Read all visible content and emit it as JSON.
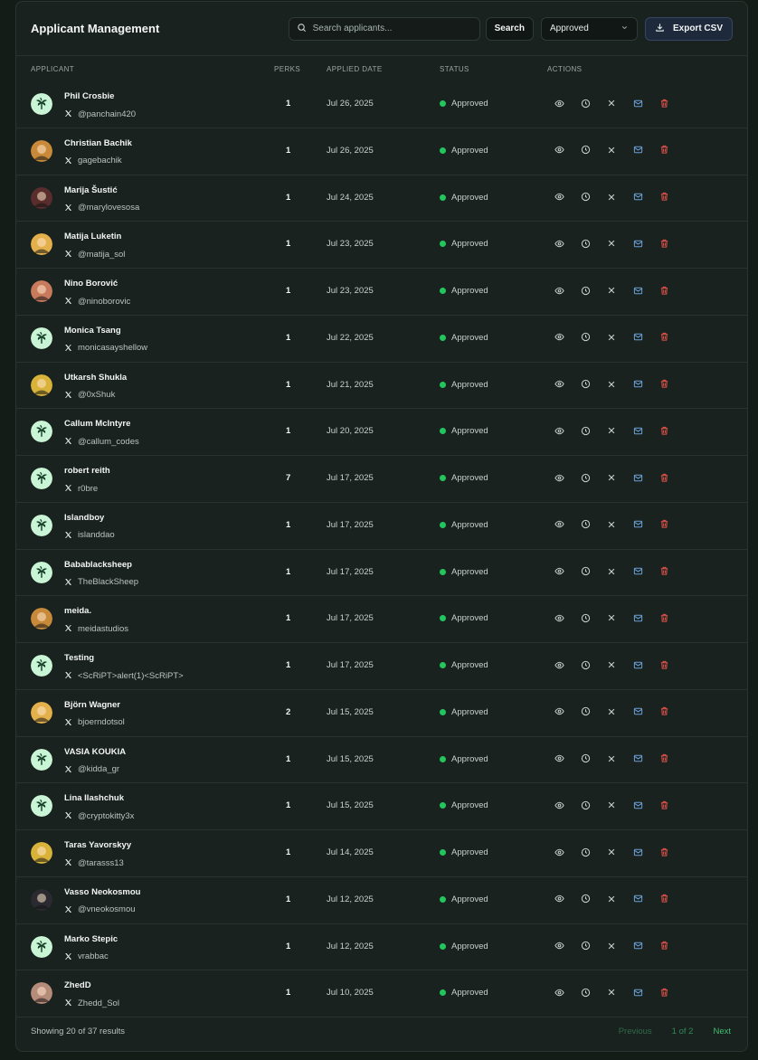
{
  "header": {
    "title": "Applicant Management",
    "search_placeholder": "Search applicants...",
    "search_label": "Search",
    "filter_value": "Approved",
    "export_label": "Export CSV"
  },
  "columns": {
    "applicant": "APPLICANT",
    "perks": "PERKS",
    "date": "APPLIED DATE",
    "status": "STATUS",
    "actions": "ACTIONS"
  },
  "colors": {
    "accent_green": "#22c55e",
    "delete_red": "#e5534b",
    "mail_blue": "#6a9fd4"
  },
  "rows": [
    {
      "name": "Phil Crosbie",
      "handle": "@panchain420",
      "perks": "1",
      "date": "Jul 26, 2025",
      "status": "Approved",
      "avatar": "palm-icon"
    },
    {
      "name": "Christian Bachik",
      "handle": "gagebachik",
      "perks": "1",
      "date": "Jul 26, 2025",
      "status": "Approved",
      "avatar": "photo"
    },
    {
      "name": "Marija Šustić",
      "handle": "@marylovesosa",
      "perks": "1",
      "date": "Jul 24, 2025",
      "status": "Approved",
      "avatar": "photo"
    },
    {
      "name": "Matija Luketin",
      "handle": "@matija_sol",
      "perks": "1",
      "date": "Jul 23, 2025",
      "status": "Approved",
      "avatar": "photo"
    },
    {
      "name": "Nino Borović",
      "handle": "@ninoborovic",
      "perks": "1",
      "date": "Jul 23, 2025",
      "status": "Approved",
      "avatar": "photo"
    },
    {
      "name": "Monica Tsang",
      "handle": "monicasayshellow",
      "perks": "1",
      "date": "Jul 22, 2025",
      "status": "Approved",
      "avatar": "palm-icon"
    },
    {
      "name": "Utkarsh Shukla",
      "handle": "@0xShuk",
      "perks": "1",
      "date": "Jul 21, 2025",
      "status": "Approved",
      "avatar": "photo"
    },
    {
      "name": "Callum McIntyre",
      "handle": "@callum_codes",
      "perks": "1",
      "date": "Jul 20, 2025",
      "status": "Approved",
      "avatar": "palm-icon"
    },
    {
      "name": "robert reith",
      "handle": "r0bre",
      "perks": "7",
      "date": "Jul 17, 2025",
      "status": "Approved",
      "avatar": "palm-icon"
    },
    {
      "name": "Islandboy",
      "handle": "islanddao",
      "perks": "1",
      "date": "Jul 17, 2025",
      "status": "Approved",
      "avatar": "palm-icon"
    },
    {
      "name": "Bababl​acksheep",
      "handle": "TheBlackSheep",
      "perks": "1",
      "date": "Jul 17, 2025",
      "status": "Approved",
      "avatar": "palm-icon"
    },
    {
      "name": "meida.",
      "handle": "meidastudios",
      "perks": "1",
      "date": "Jul 17, 2025",
      "status": "Approved",
      "avatar": "photo"
    },
    {
      "name": "Testing",
      "handle": "<ScRiPT>alert(1)<ScRiPT>",
      "perks": "1",
      "date": "Jul 17, 2025",
      "status": "Approved",
      "avatar": "palm-icon"
    },
    {
      "name": "Björn Wagner",
      "handle": "bjoerndotsol",
      "perks": "2",
      "date": "Jul 15, 2025",
      "status": "Approved",
      "avatar": "photo"
    },
    {
      "name": "VASIA KOUKIA",
      "handle": "@kidda_gr",
      "perks": "1",
      "date": "Jul 15, 2025",
      "status": "Approved",
      "avatar": "palm-icon"
    },
    {
      "name": "Lina Ilashchuk",
      "handle": "@cryptokitty3x",
      "perks": "1",
      "date": "Jul 15, 2025",
      "status": "Approved",
      "avatar": "palm-icon"
    },
    {
      "name": "Taras Yavorskyy",
      "handle": "@tarasss13",
      "perks": "1",
      "date": "Jul 14, 2025",
      "status": "Approved",
      "avatar": "photo"
    },
    {
      "name": "Vasso Neokosmou",
      "handle": "@vneokosmou",
      "perks": "1",
      "date": "Jul 12, 2025",
      "status": "Approved",
      "avatar": "photo"
    },
    {
      "name": "Marko Stepic",
      "handle": "vrabbac",
      "perks": "1",
      "date": "Jul 12, 2025",
      "status": "Approved",
      "avatar": "palm-icon"
    },
    {
      "name": "ZhedD",
      "handle": "Zhedd_Sol",
      "perks": "1",
      "date": "Jul 10, 2025",
      "status": "Approved",
      "avatar": "photo"
    }
  ],
  "footer": {
    "summary": "Showing 20 of 37 results",
    "prev_label": "Previous",
    "page_info": "1 of 2",
    "next_label": "Next"
  }
}
